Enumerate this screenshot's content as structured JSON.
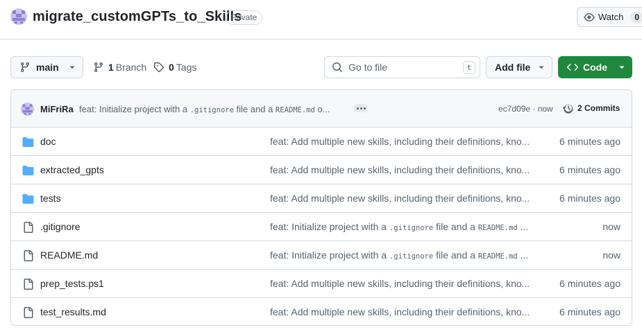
{
  "repo": {
    "name": "migrate_customGPTs_to_Skills",
    "visibility": "Private"
  },
  "watch": {
    "label": "Watch",
    "count": "0"
  },
  "branch": {
    "name": "main",
    "branch_count": "1",
    "branch_label": "Branch",
    "tag_count": "0",
    "tag_label": "Tags"
  },
  "search": {
    "placeholder": "Go to file",
    "shortcut": "t"
  },
  "buttons": {
    "add_file": "Add file",
    "code": "Code"
  },
  "colors": {
    "accent_green": "#1f883d",
    "folder_blue": "#54aeff",
    "muted": "#59636e"
  },
  "latest_commit": {
    "author": "MiFriRa",
    "message_prefix": "feat: Initialize project with a ",
    "message_code_1": ".gitignore",
    "message_mid": " file and a ",
    "message_code_2": "README.md",
    "message_suffix": " o...",
    "sha": "ec7d09e · now",
    "commits_label": "2 Commits"
  },
  "files": [
    {
      "name": "doc",
      "type": "folder",
      "message": "feat: Add multiple new skills, including their definitions, kno...",
      "time": "6 minutes ago"
    },
    {
      "name": "extracted_gpts",
      "type": "folder",
      "message": "feat: Add multiple new skills, including their definitions, kno...",
      "time": "6 minutes ago"
    },
    {
      "name": "tests",
      "type": "folder",
      "message": "feat: Add multiple new skills, including their definitions, kno...",
      "time": "6 minutes ago"
    },
    {
      "name": ".gitignore",
      "type": "file",
      "message_prefix": "feat: Initialize project with a ",
      "message_code_1": ".gitignore",
      "message_mid": " file and a ",
      "message_code_2": "README.md",
      "message_suffix": " ...",
      "time": "now"
    },
    {
      "name": "README.md",
      "type": "file",
      "message_prefix": "feat: Initialize project with a ",
      "message_code_1": ".gitignore",
      "message_mid": " file and a ",
      "message_code_2": "README.md",
      "message_suffix": " ...",
      "time": "now"
    },
    {
      "name": "prep_tests.ps1",
      "type": "file",
      "message": "feat: Add multiple new skills, including their definitions, kno...",
      "time": "6 minutes ago"
    },
    {
      "name": "test_results.md",
      "type": "file",
      "message": "feat: Add multiple new skills, including their definitions, kno...",
      "time": "6 minutes ago"
    }
  ]
}
